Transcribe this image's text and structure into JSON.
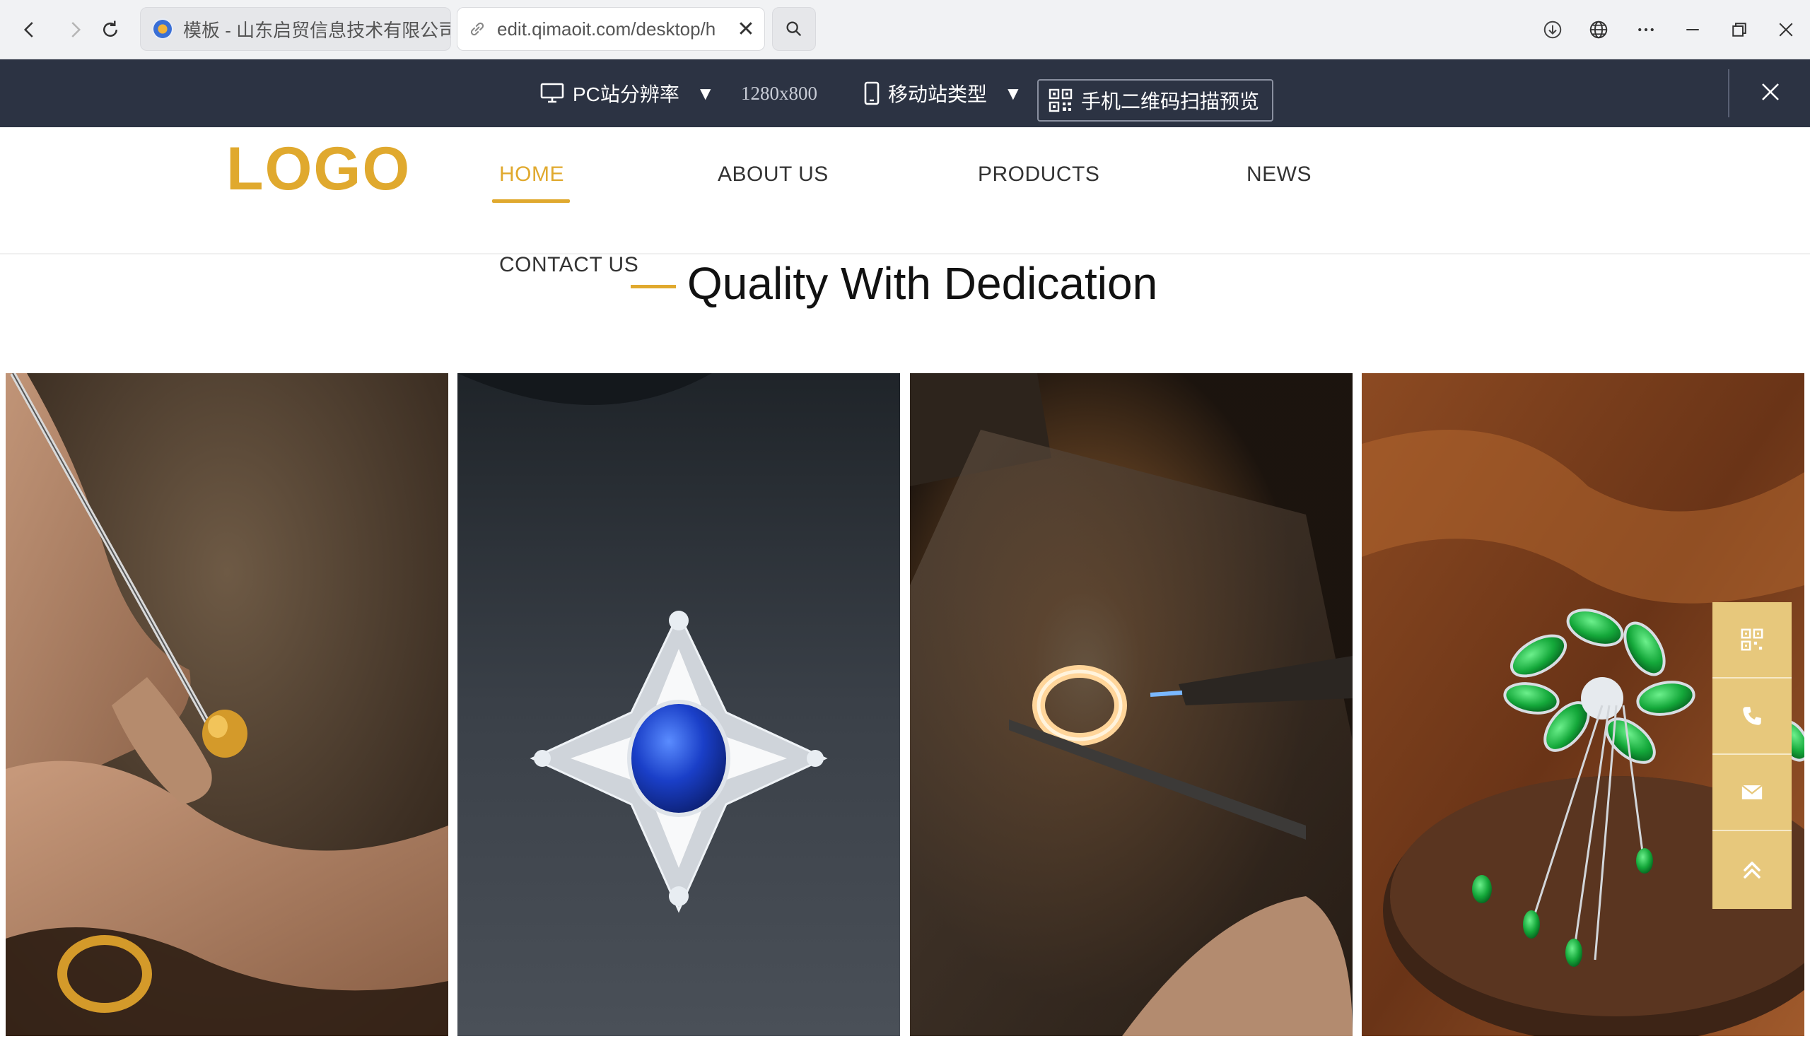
{
  "browser": {
    "tabs": [
      {
        "title": "模板 - 山东启贸信息技术有限公司",
        "icon": "site-favicon"
      },
      {
        "title": "edit.qimaoit.com/desktop/h",
        "icon": "link-icon"
      }
    ],
    "close_symbol": "✕"
  },
  "editor_toolbar": {
    "resolution_label": "PC站分辨率",
    "resolution_value": "1280x800",
    "mobile_type_label": "移动站类型",
    "qr_preview_label": "手机二维码扫描预览",
    "caret": "▼"
  },
  "site": {
    "logo": "LOGO",
    "nav": {
      "home": "HOME",
      "about": "ABOUT US",
      "products": "PRODUCTS",
      "news": "NEWS",
      "contact": "CONTACT US"
    },
    "headline": "Quality With Dedication",
    "accent_color": "#e0a92e",
    "gallery": [
      {
        "subject": "hands-crafting-gold-ring"
      },
      {
        "subject": "sapphire-diamond-ring"
      },
      {
        "subject": "torch-heating-ring"
      },
      {
        "subject": "jade-brooch-on-wood"
      }
    ],
    "float_tools": [
      "qr-code-icon",
      "phone-icon",
      "mail-icon",
      "back-to-top-icon"
    ]
  }
}
